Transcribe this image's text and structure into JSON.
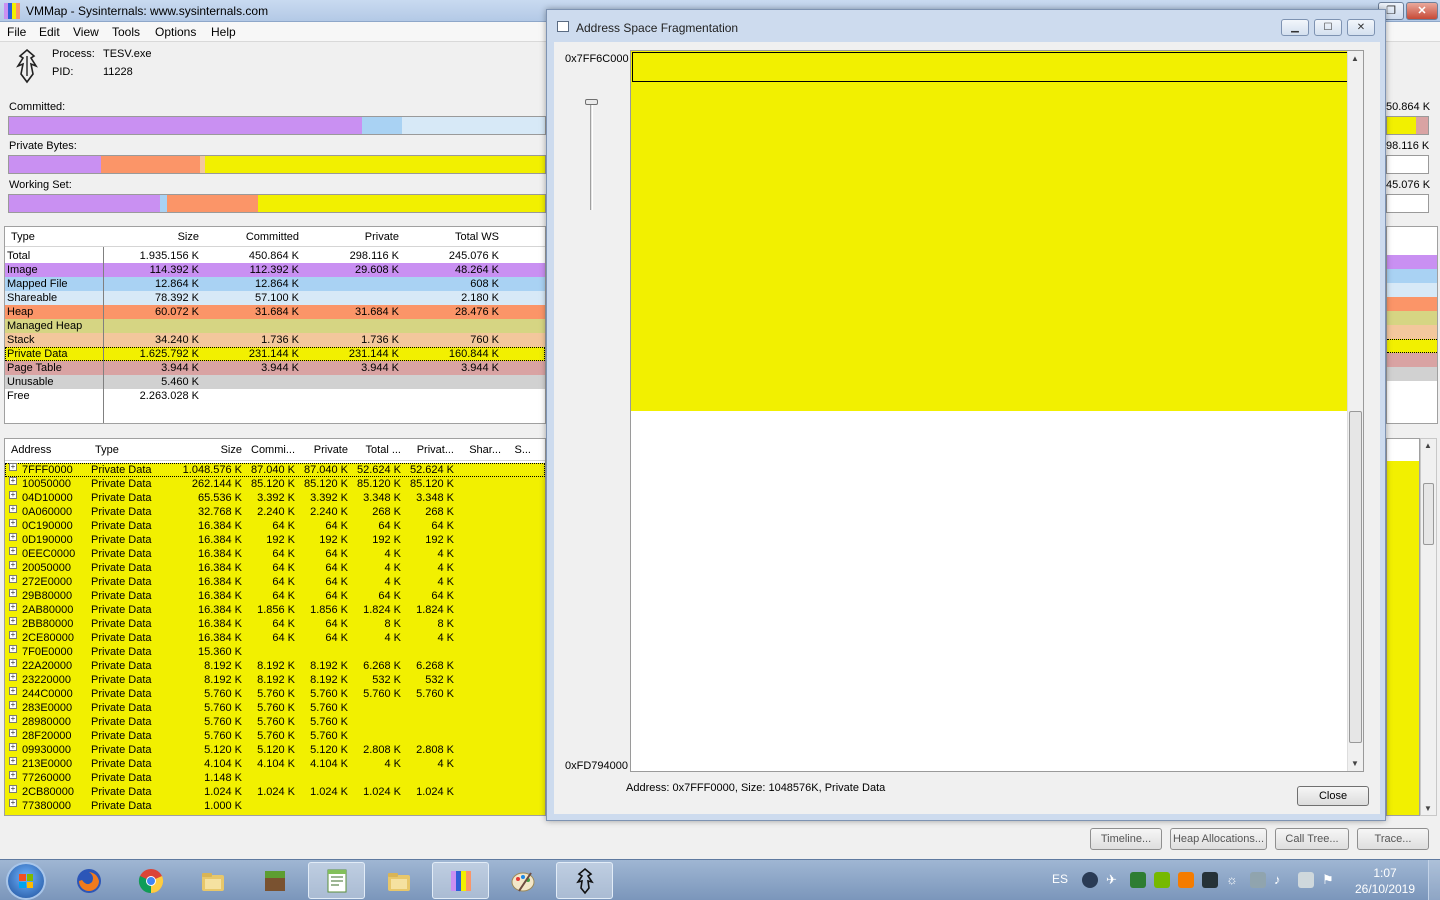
{
  "window": {
    "title": "VMMap - Sysinternals: www.sysinternals.com"
  },
  "menu": [
    "File",
    "Edit",
    "View",
    "Tools",
    "Options",
    "Help"
  ],
  "process": {
    "process_label": "Process:",
    "process_name": "TESV.exe",
    "pid_label": "PID:",
    "pid": "11228"
  },
  "bars": {
    "committed": {
      "label": "Committed:",
      "right_value": "50.864 K"
    },
    "private_bytes": {
      "label": "Private Bytes:",
      "right_value": "98.116 K"
    },
    "working_set": {
      "label": "Working Set:",
      "right_value": "45.076 K"
    }
  },
  "summary": {
    "columns": [
      "Type",
      "Size",
      "Committed",
      "Private",
      "Total WS"
    ],
    "rows": [
      {
        "type": "Total",
        "size": "1.935.156 K",
        "committed": "450.864 K",
        "private": "298.116 K",
        "total_ws": "245.076 K",
        "color": "#ffffff"
      },
      {
        "type": "Image",
        "size": "114.392 K",
        "committed": "112.392 K",
        "private": "29.608 K",
        "total_ws": "48.264 K",
        "color": "#c990f2"
      },
      {
        "type": "Mapped File",
        "size": "12.864 K",
        "committed": "12.864 K",
        "private": "",
        "total_ws": "608 K",
        "color": "#a9d2f3"
      },
      {
        "type": "Shareable",
        "size": "78.392 K",
        "committed": "57.100 K",
        "private": "",
        "total_ws": "2.180 K",
        "color": "#d7e9f7"
      },
      {
        "type": "Heap",
        "size": "60.072 K",
        "committed": "31.684 K",
        "private": "31.684 K",
        "total_ws": "28.476 K",
        "color": "#fb9568"
      },
      {
        "type": "Managed Heap",
        "size": "",
        "committed": "",
        "private": "",
        "total_ws": "",
        "color": "#d6d583"
      },
      {
        "type": "Stack",
        "size": "34.240 K",
        "committed": "1.736 K",
        "private": "1.736 K",
        "total_ws": "760 K",
        "color": "#f3c79c"
      },
      {
        "type": "Private Data",
        "size": "1.625.792 K",
        "committed": "231.144 K",
        "private": "231.144 K",
        "total_ws": "160.844 K",
        "color": "#f2f000"
      },
      {
        "type": "Page Table",
        "size": "3.944 K",
        "committed": "3.944 K",
        "private": "3.944 K",
        "total_ws": "3.944 K",
        "color": "#d9a3a3"
      },
      {
        "type": "Unusable",
        "size": "5.460 K",
        "committed": "",
        "private": "",
        "total_ws": "",
        "color": "#d1d1d1"
      },
      {
        "type": "Free",
        "size": "2.263.028 K",
        "committed": "",
        "private": "",
        "total_ws": "",
        "color": "#ffffff"
      }
    ]
  },
  "detail": {
    "columns": [
      "Address",
      "Type",
      "Size",
      "Commi...",
      "Private",
      "Total ...",
      "Privat...",
      "Shar...",
      "S..."
    ],
    "rows": [
      {
        "address": "7FFF0000",
        "type": "Private Data",
        "size": "1.048.576 K",
        "committed": "87.040 K",
        "private": "87.040 K",
        "total": "52.624 K",
        "private_ws": "52.624 K"
      },
      {
        "address": "10050000",
        "type": "Private Data",
        "size": "262.144 K",
        "committed": "85.120 K",
        "private": "85.120 K",
        "total": "85.120 K",
        "private_ws": "85.120 K"
      },
      {
        "address": "04D10000",
        "type": "Private Data",
        "size": "65.536 K",
        "committed": "3.392 K",
        "private": "3.392 K",
        "total": "3.348 K",
        "private_ws": "3.348 K"
      },
      {
        "address": "0A060000",
        "type": "Private Data",
        "size": "32.768 K",
        "committed": "2.240 K",
        "private": "2.240 K",
        "total": "268 K",
        "private_ws": "268 K"
      },
      {
        "address": "0C190000",
        "type": "Private Data",
        "size": "16.384 K",
        "committed": "64 K",
        "private": "64 K",
        "total": "64 K",
        "private_ws": "64 K"
      },
      {
        "address": "0D190000",
        "type": "Private Data",
        "size": "16.384 K",
        "committed": "192 K",
        "private": "192 K",
        "total": "192 K",
        "private_ws": "192 K"
      },
      {
        "address": "0EEC0000",
        "type": "Private Data",
        "size": "16.384 K",
        "committed": "64 K",
        "private": "64 K",
        "total": "4 K",
        "private_ws": "4 K"
      },
      {
        "address": "20050000",
        "type": "Private Data",
        "size": "16.384 K",
        "committed": "64 K",
        "private": "64 K",
        "total": "4 K",
        "private_ws": "4 K"
      },
      {
        "address": "272E0000",
        "type": "Private Data",
        "size": "16.384 K",
        "committed": "64 K",
        "private": "64 K",
        "total": "4 K",
        "private_ws": "4 K"
      },
      {
        "address": "29B80000",
        "type": "Private Data",
        "size": "16.384 K",
        "committed": "64 K",
        "private": "64 K",
        "total": "64 K",
        "private_ws": "64 K"
      },
      {
        "address": "2AB80000",
        "type": "Private Data",
        "size": "16.384 K",
        "committed": "1.856 K",
        "private": "1.856 K",
        "total": "1.824 K",
        "private_ws": "1.824 K"
      },
      {
        "address": "2BB80000",
        "type": "Private Data",
        "size": "16.384 K",
        "committed": "64 K",
        "private": "64 K",
        "total": "8 K",
        "private_ws": "8 K"
      },
      {
        "address": "2CE80000",
        "type": "Private Data",
        "size": "16.384 K",
        "committed": "64 K",
        "private": "64 K",
        "total": "4 K",
        "private_ws": "4 K"
      },
      {
        "address": "7F0E0000",
        "type": "Private Data",
        "size": "15.360 K",
        "committed": "",
        "private": "",
        "total": "",
        "private_ws": ""
      },
      {
        "address": "22A20000",
        "type": "Private Data",
        "size": "8.192 K",
        "committed": "8.192 K",
        "private": "8.192 K",
        "total": "6.268 K",
        "private_ws": "6.268 K"
      },
      {
        "address": "23220000",
        "type": "Private Data",
        "size": "8.192 K",
        "committed": "8.192 K",
        "private": "8.192 K",
        "total": "532 K",
        "private_ws": "532 K"
      },
      {
        "address": "244C0000",
        "type": "Private Data",
        "size": "5.760 K",
        "committed": "5.760 K",
        "private": "5.760 K",
        "total": "5.760 K",
        "private_ws": "5.760 K"
      },
      {
        "address": "283E0000",
        "type": "Private Data",
        "size": "5.760 K",
        "committed": "5.760 K",
        "private": "5.760 K",
        "total": "",
        "private_ws": ""
      },
      {
        "address": "28980000",
        "type": "Private Data",
        "size": "5.760 K",
        "committed": "5.760 K",
        "private": "5.760 K",
        "total": "",
        "private_ws": ""
      },
      {
        "address": "28F20000",
        "type": "Private Data",
        "size": "5.760 K",
        "committed": "5.760 K",
        "private": "5.760 K",
        "total": "",
        "private_ws": ""
      },
      {
        "address": "09930000",
        "type": "Private Data",
        "size": "5.120 K",
        "committed": "5.120 K",
        "private": "5.120 K",
        "total": "2.808 K",
        "private_ws": "2.808 K"
      },
      {
        "address": "213E0000",
        "type": "Private Data",
        "size": "4.104 K",
        "committed": "4.104 K",
        "private": "4.104 K",
        "total": "4 K",
        "private_ws": "4 K"
      },
      {
        "address": "77260000",
        "type": "Private Data",
        "size": "1.148 K",
        "committed": "",
        "private": "",
        "total": "",
        "private_ws": ""
      },
      {
        "address": "2CB80000",
        "type": "Private Data",
        "size": "1.024 K",
        "committed": "1.024 K",
        "private": "1.024 K",
        "total": "1.024 K",
        "private_ws": "1.024 K"
      },
      {
        "address": "77380000",
        "type": "Private Data",
        "size": "1.000 K",
        "committed": "",
        "private": "",
        "total": "",
        "private_ws": ""
      }
    ]
  },
  "bottom_buttons": [
    "Timeline...",
    "Heap Allocations...",
    "Call Tree...",
    "Trace..."
  ],
  "dialog": {
    "title": "Address Space Fragmentation",
    "top_address": "0x7FF6C000",
    "bottom_address": "0xFD794000",
    "filled_fraction": 0.5,
    "status": "Address: 0x7FFF0000, Size: 1048576K, Private Data",
    "close_label": "Close",
    "fill_color": "#f2f000"
  },
  "taskbar": {
    "language": "ES",
    "time": "1:07",
    "date": "26/10/2019",
    "apps": [
      "firefox-icon",
      "chrome-icon",
      "explorer-icon",
      "minecraft-icon",
      "notepad-icon",
      "explorer-icon",
      "vmmap-icon",
      "paint-icon",
      "skyrim-icon"
    ]
  },
  "colors": {
    "image": "#c990f2",
    "mapped": "#a9d2f3",
    "shareable": "#d7e9f7",
    "heap": "#fb9568",
    "private": "#f2f000",
    "stack": "#f3c79c",
    "page_table": "#d9a3a3",
    "unusable": "#d1d1d1"
  }
}
